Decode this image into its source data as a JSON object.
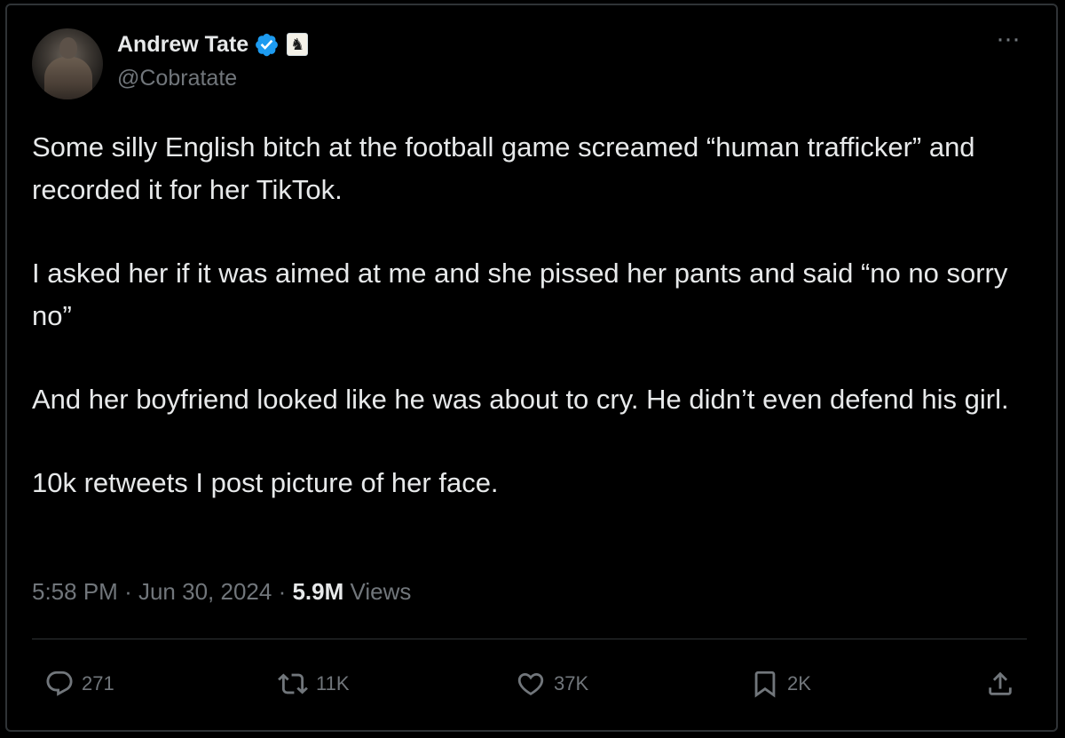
{
  "author": {
    "name": "Andrew Tate",
    "handle": "@Cobratate",
    "verified": true,
    "verified_color": "#1d9bf0",
    "affiliate_badge_icon": "chess-knight-icon",
    "avatar_icon": "profile-photo"
  },
  "menu": {
    "more_icon": "more-options-icon"
  },
  "tweet": {
    "paragraphs": [
      "Some silly English bitch at the football game screamed “human trafficker” and recorded it for her TikTok.",
      "I asked her if it was aimed at me and she pissed her pants and said “no no sorry no”",
      "And her boyfriend looked like he was about to cry. He didn’t even defend his girl.",
      "10k retweets I post picture of her face."
    ]
  },
  "meta": {
    "time": "5:58 PM",
    "separator": "·",
    "date": "Jun 30, 2024",
    "views_count": "5.9M",
    "views_label": "Views"
  },
  "actions": {
    "reply": {
      "icon": "reply-icon",
      "count": "271"
    },
    "retweet": {
      "icon": "retweet-icon",
      "count": "11K"
    },
    "like": {
      "icon": "heart-icon",
      "count": "37K"
    },
    "bookmark": {
      "icon": "bookmark-icon",
      "count": "2K"
    },
    "share": {
      "icon": "share-icon"
    }
  },
  "colors": {
    "background": "#000000",
    "text_primary": "#e7e9ea",
    "text_secondary": "#71767b",
    "border": "#2f3336"
  }
}
